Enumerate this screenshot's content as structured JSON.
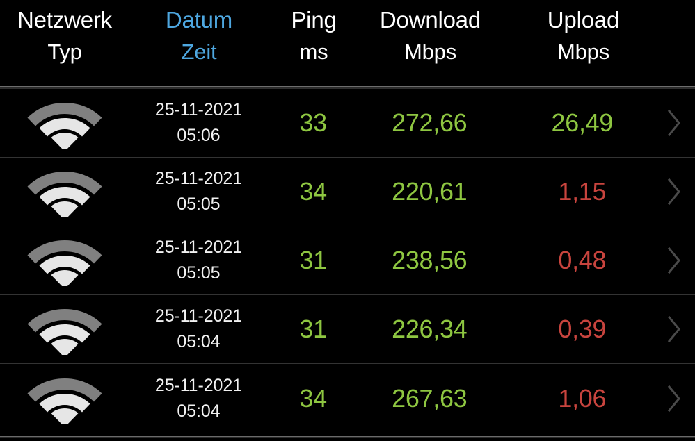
{
  "table": {
    "columns": [
      {
        "key": "type",
        "line1": "Netzwerk",
        "line2": "Typ",
        "color": "white",
        "icon": "wifi-icon"
      },
      {
        "key": "datetime",
        "line1": "Datum",
        "line2": "Zeit",
        "color": "blue"
      },
      {
        "key": "ping",
        "line1": "Ping",
        "line2": "ms",
        "color": "white"
      },
      {
        "key": "download",
        "line1": "Download",
        "line2": "Mbps",
        "color": "white"
      },
      {
        "key": "upload",
        "line1": "Upload",
        "line2": "Mbps",
        "color": "white"
      }
    ],
    "rows": [
      {
        "network_icon": "wifi-icon",
        "date": "25-11-2021",
        "time": "05:06",
        "ping": "33",
        "download": "272,66",
        "upload": "26,49",
        "ping_state": "good",
        "download_state": "good",
        "upload_state": "good",
        "chevron": "chevron-right-icon"
      },
      {
        "network_icon": "wifi-icon",
        "date": "25-11-2021",
        "time": "05:05",
        "ping": "34",
        "download": "220,61",
        "upload": "1,15",
        "ping_state": "good",
        "download_state": "good",
        "upload_state": "bad",
        "chevron": "chevron-right-icon"
      },
      {
        "network_icon": "wifi-icon",
        "date": "25-11-2021",
        "time": "05:05",
        "ping": "31",
        "download": "238,56",
        "upload": "0,48",
        "ping_state": "good",
        "download_state": "good",
        "upload_state": "bad",
        "chevron": "chevron-right-icon"
      },
      {
        "network_icon": "wifi-icon",
        "date": "25-11-2021",
        "time": "05:04",
        "ping": "31",
        "download": "226,34",
        "upload": "0,39",
        "ping_state": "good",
        "download_state": "good",
        "upload_state": "bad",
        "chevron": "chevron-right-icon"
      },
      {
        "network_icon": "wifi-icon",
        "date": "25-11-2021",
        "time": "05:04",
        "ping": "34",
        "download": "267,63",
        "upload": "1,06",
        "ping_state": "good",
        "download_state": "good",
        "upload_state": "bad",
        "chevron": "chevron-right-icon"
      }
    ]
  },
  "colors": {
    "background": "#000000",
    "header_text": "#ffffff",
    "header_accent": "#4ea7e0",
    "value_good": "#8ec641",
    "value_bad": "#c8443e",
    "row_divider": "#333333",
    "wifi_outer_arc": "#808080",
    "wifi_inner": "#e6e6e6",
    "chevron": "#4a4a4a"
  }
}
